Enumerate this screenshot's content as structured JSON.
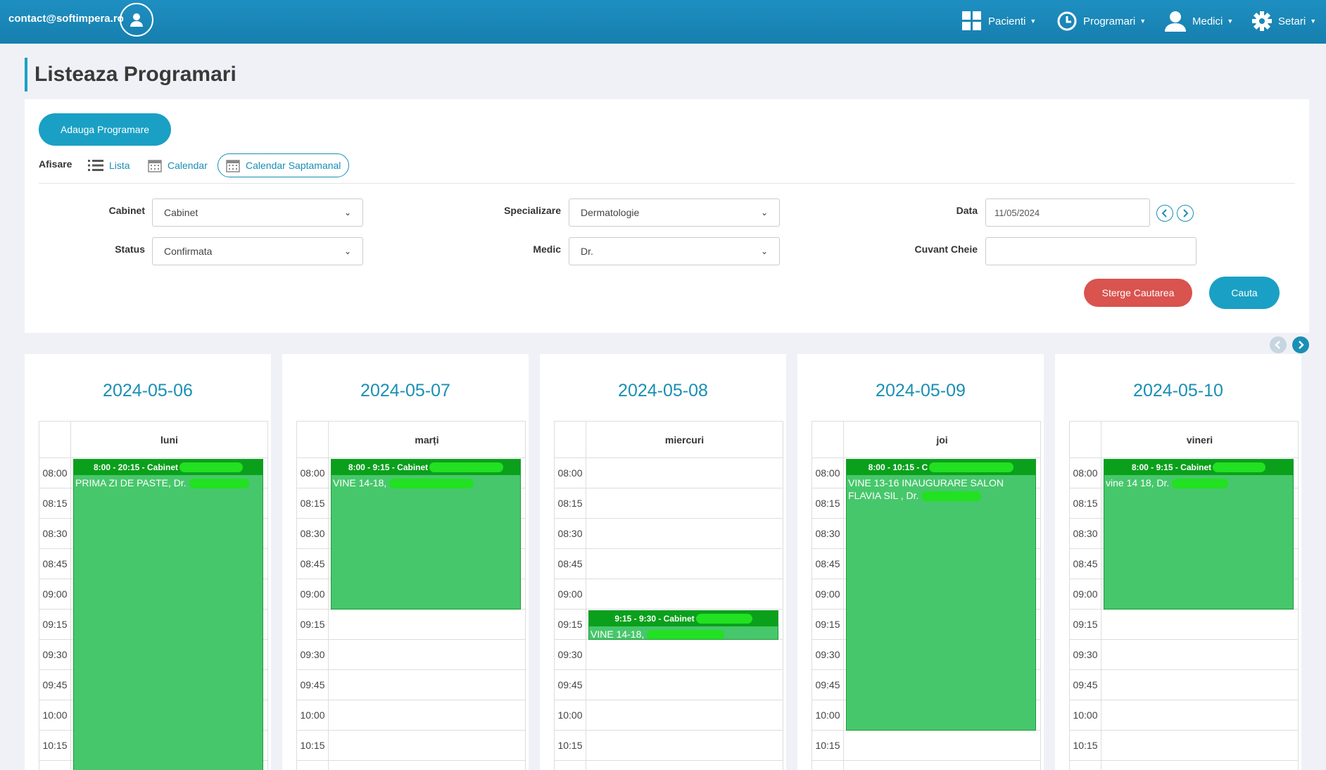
{
  "topbar": {
    "email": "contact@softimpera.ro",
    "nav": [
      {
        "label": "Pacienti",
        "icon": "grid-icon"
      },
      {
        "label": "Programari",
        "icon": "clock-icon"
      },
      {
        "label": "Medici",
        "icon": "user-icon"
      },
      {
        "label": "Setari",
        "icon": "gear-icon"
      }
    ]
  },
  "page": {
    "title": "Listeaza Programari"
  },
  "panel": {
    "add_button": "Adauga Programare",
    "display_label": "Afisare",
    "views": [
      "Lista",
      "Calendar",
      "Calendar Saptamanal"
    ],
    "filters": {
      "cabinet_label": "Cabinet",
      "cabinet_value": "Cabinet",
      "status_label": "Status",
      "status_value": "Confirmata",
      "specializare_label": "Specializare",
      "specializare_value": "Dermatologie",
      "medic_label": "Medic",
      "medic_value": "Dr.",
      "data_label": "Data",
      "data_value": "11/05/2024",
      "keyword_label": "Cuvant Cheie",
      "keyword_value": ""
    },
    "clear_button": "Sterge Cautarea",
    "search_button": "Cauta"
  },
  "times": [
    "08:00",
    "08:15",
    "08:30",
    "08:45",
    "09:00",
    "09:15",
    "09:30",
    "09:45",
    "10:00",
    "10:15"
  ],
  "days": [
    {
      "date": "2024-05-06",
      "name": "luni"
    },
    {
      "date": "2024-05-07",
      "name": "marți"
    },
    {
      "date": "2024-05-08",
      "name": "miercuri"
    },
    {
      "date": "2024-05-09",
      "name": "joi"
    },
    {
      "date": "2024-05-10",
      "name": "vineri"
    }
  ],
  "events": [
    {
      "day": 0,
      "head": "8:00 - 20:15 - Cabinet",
      "body": "PRIMA ZI DE PASTE, Dr.",
      "body2": ""
    },
    {
      "day": 1,
      "head": "8:00 - 9:15 - Cabinet",
      "body": "VINE 14-18,",
      "body2": ""
    },
    {
      "day": 2,
      "head": "9:15 - 9:30 - Cabinet",
      "body": "VINE 14-18,",
      "body2": ""
    },
    {
      "day": 3,
      "head": "8:00 - 10:15 - C",
      "body": "VINE 13-16 INAUGURARE SALON",
      "body2": "FLAVIA SIL , Dr."
    },
    {
      "day": 4,
      "head": "8:00 - 9:15 - Cabinet",
      "body": "vine 14 18, Dr.",
      "body2": ""
    }
  ],
  "colors": {
    "accent": "#1aa0c4",
    "event": "#47c76b",
    "event_head": "#0ba01b",
    "danger": "#d9534f",
    "topbar": "#1a87b8"
  }
}
